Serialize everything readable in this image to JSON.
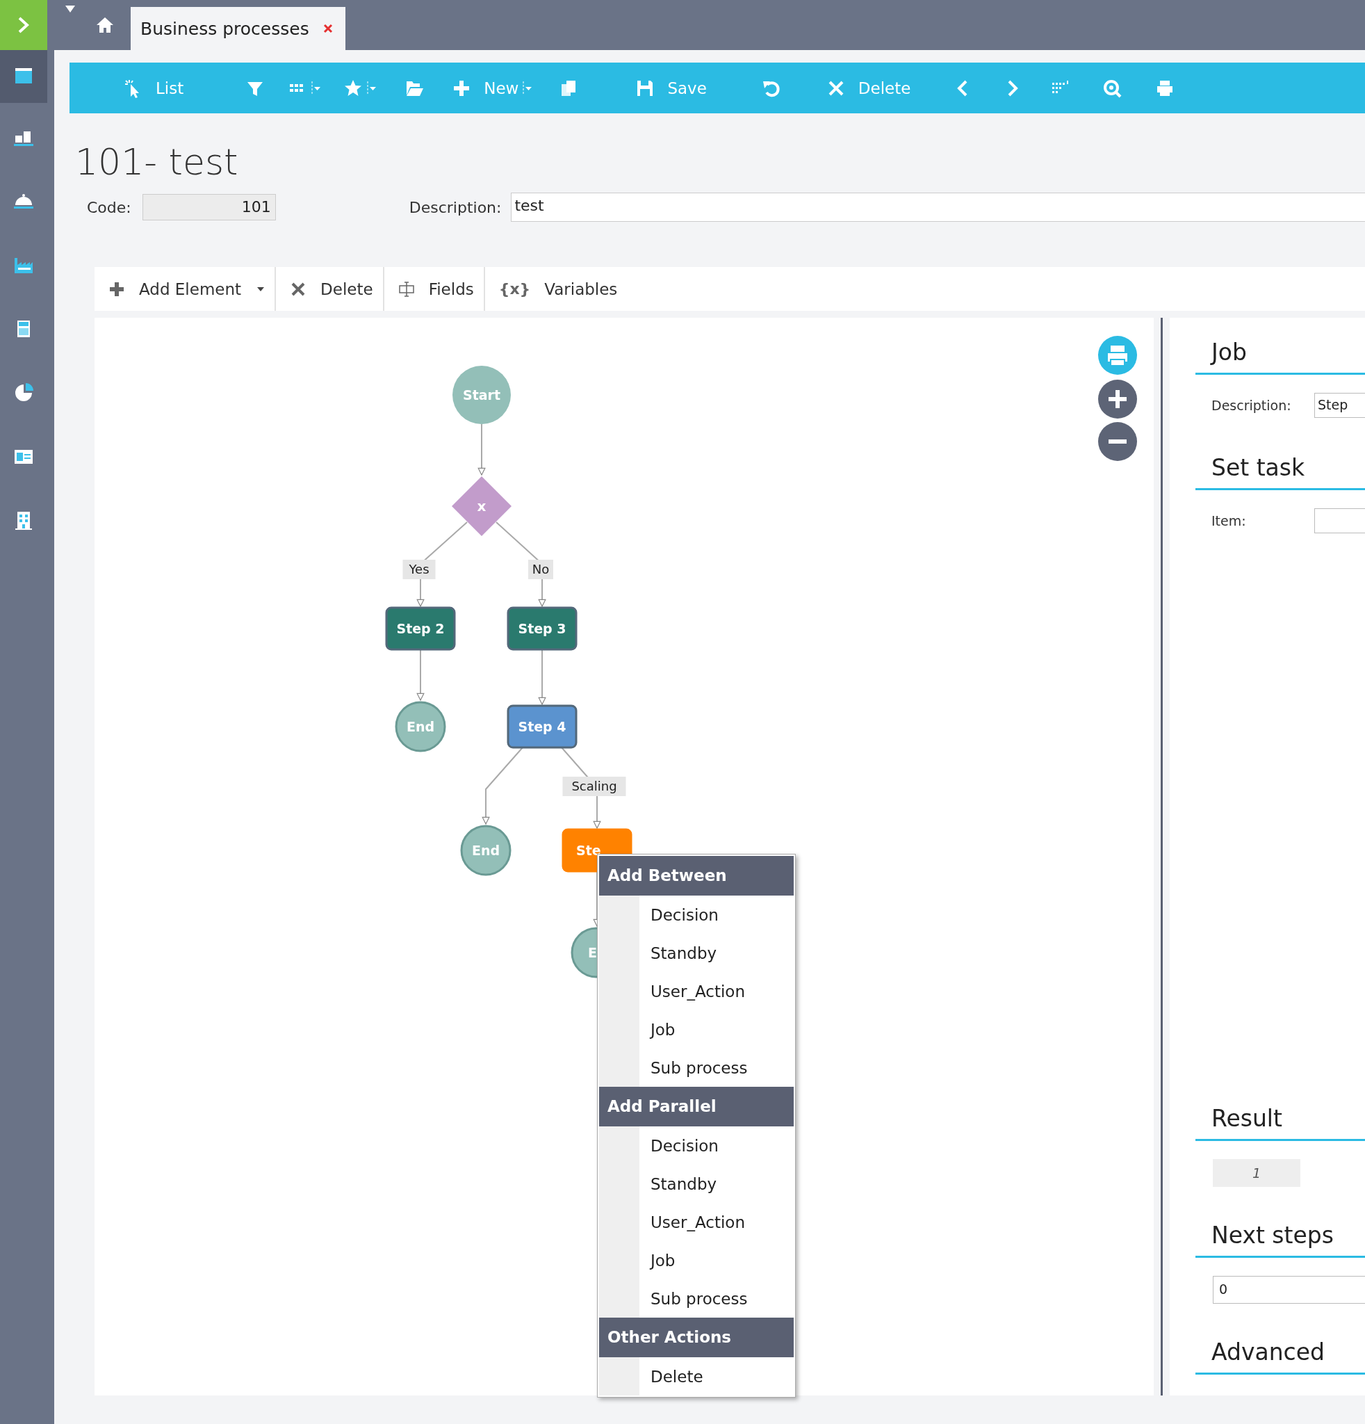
{
  "sidebar": {
    "items": [
      {
        "selected": true
      },
      {
        "selected": false
      },
      {
        "selected": false
      },
      {
        "selected": false
      },
      {
        "selected": false
      },
      {
        "selected": false
      },
      {
        "selected": false
      },
      {
        "selected": false
      }
    ]
  },
  "tabs": [
    {
      "label": "Business processes",
      "selected": true
    }
  ],
  "toolbar": [
    {
      "label": "List"
    },
    {
      "label": "New"
    },
    {
      "label": "Save"
    },
    {
      "label": "Delete"
    }
  ],
  "record": {
    "title": "101- test",
    "code_label": "Code:",
    "code": "101",
    "description_label": "Description:",
    "description": "test"
  },
  "diagram_toolbar": [
    {
      "label": "Add Element"
    },
    {
      "label": "Delete"
    },
    {
      "label": "Fields"
    },
    {
      "label": "Variables",
      "glyph": "{x}"
    }
  ],
  "diagram": {
    "nodes": [
      {
        "kind": "start",
        "label": "Start"
      },
      {
        "kind": "decision",
        "label": "x"
      },
      {
        "kind": "step",
        "label": "Step 2",
        "color": "#2a7a6e"
      },
      {
        "kind": "step",
        "label": "Step 3",
        "color": "#2a7a6e"
      },
      {
        "kind": "end",
        "label": "End"
      },
      {
        "kind": "step",
        "label": "Step 4",
        "color": "#5b93cf"
      },
      {
        "kind": "end",
        "label": "End"
      },
      {
        "kind": "step",
        "label": "Ste",
        "color": "#ff8200"
      },
      {
        "kind": "end",
        "label": "E"
      }
    ],
    "edge_labels": [
      "Yes",
      "No",
      "Scaling"
    ]
  },
  "context_menu": {
    "sections": [
      {
        "title": "Add Between",
        "items": [
          "Decision",
          "Standby",
          "User_Action",
          "Job",
          "Sub process"
        ]
      },
      {
        "title": "Add Parallel",
        "items": [
          "Decision",
          "Standby",
          "User_Action",
          "Job",
          "Sub process"
        ]
      },
      {
        "title": "Other Actions",
        "items": [
          "Delete"
        ]
      }
    ]
  },
  "panel": {
    "sections": [
      {
        "kind": "form",
        "title": "Job",
        "fields": [
          {
            "label": "Description:",
            "value": "Step"
          }
        ]
      },
      {
        "kind": "form",
        "title": "Set task",
        "fields": [
          {
            "label": "Item:"
          }
        ]
      },
      {
        "kind": "readonly",
        "title": "Result",
        "value": "1"
      },
      {
        "kind": "input",
        "title": "Next steps",
        "value": "0"
      },
      {
        "kind": "heading",
        "title": "Advanced"
      }
    ]
  }
}
